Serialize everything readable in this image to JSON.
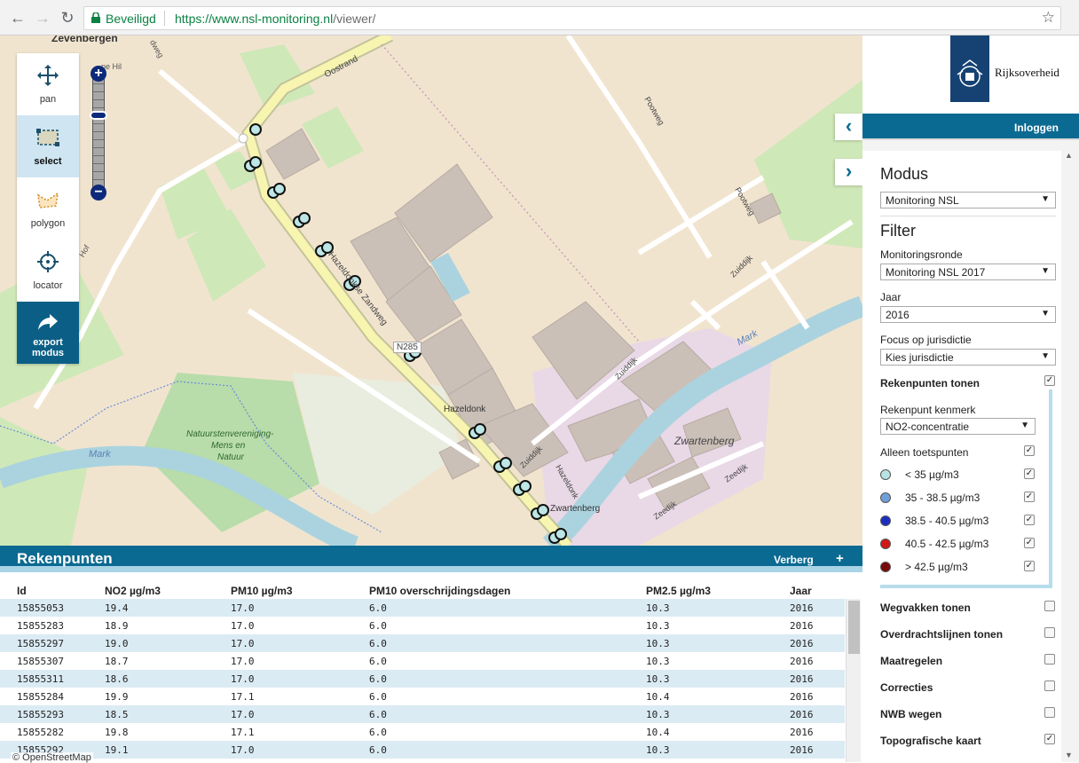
{
  "browser": {
    "secure_label": "Beveiligd",
    "url_origin": "https://www.nsl-monitoring.nl",
    "url_path": "/viewer/"
  },
  "map": {
    "labels": {
      "zevenbergen": "Zevenbergen",
      "oostrand": "Oostrand",
      "pootweg_1": "Pootweg",
      "pootweg_2": "Pootweg",
      "zuiddijk_1": "Zuiddijk",
      "zuiddijk_2": "Zuiddijk",
      "zuiddijk_3": "Zuiddijk",
      "hazeldonkse_zandweg": "Hazeldonkse Zandweg",
      "n285": "N285",
      "hazeldonk": "Hazeldonk",
      "hazeldonk_2": "Hazeldonk",
      "zwartenberg_1": "Zwartenberg",
      "zwartenberg_2": "Zwartenberg",
      "zeedijk_1": "Zeedijk",
      "zeedijk_2": "Zeedijk",
      "mark_1": "Mark",
      "mark_2": "Mark",
      "natuur_1": "Natuurstenvereniging-",
      "natuur_2": "Mens en",
      "natuur_3": "Natuur",
      "hof": "Hof",
      "dwaag": "dweg",
      "pe_hil": "pe Hil"
    }
  },
  "toolbar": {
    "items": [
      {
        "label": "pan",
        "icon": "move-icon"
      },
      {
        "label": "select",
        "icon": "select-box-icon"
      },
      {
        "label": "polygon",
        "icon": "polygon-icon"
      },
      {
        "label": "locator",
        "icon": "crosshair-icon"
      },
      {
        "label": "export\nmodus",
        "icon": "share-arrow-icon"
      }
    ],
    "active": "select"
  },
  "zoom": {
    "in": "+",
    "out": "−"
  },
  "rekenpunten": {
    "title": "Rekenpunten",
    "hide_label": "Verberg",
    "plus_label": "+",
    "columns": [
      "Id",
      "NO2 µg/m3",
      "PM10 µg/m3",
      "PM10 overschrijdingsdagen",
      "PM2.5 µg/m3",
      "Jaar"
    ],
    "rows": [
      [
        "15855053",
        "19.4",
        "17.0",
        "6.0",
        "10.3",
        "2016"
      ],
      [
        "15855283",
        "18.9",
        "17.0",
        "6.0",
        "10.3",
        "2016"
      ],
      [
        "15855297",
        "19.0",
        "17.0",
        "6.0",
        "10.3",
        "2016"
      ],
      [
        "15855307",
        "18.7",
        "17.0",
        "6.0",
        "10.3",
        "2016"
      ],
      [
        "15855311",
        "18.6",
        "17.0",
        "6.0",
        "10.3",
        "2016"
      ],
      [
        "15855284",
        "19.9",
        "17.1",
        "6.0",
        "10.4",
        "2016"
      ],
      [
        "15855293",
        "18.5",
        "17.0",
        "6.0",
        "10.3",
        "2016"
      ],
      [
        "15855282",
        "19.8",
        "17.1",
        "6.0",
        "10.4",
        "2016"
      ],
      [
        "15855292",
        "19.1",
        "17.0",
        "6.0",
        "10.3",
        "2016"
      ]
    ],
    "credit": "© OpenStreetMap"
  },
  "panel": {
    "brand": "Rijksoverheid",
    "login": "Inloggen",
    "modus_heading": "Modus",
    "modus_value": "Monitoring NSL",
    "filter_heading": "Filter",
    "ronde_label": "Monitoringsronde",
    "ronde_value": "Monitoring NSL 2017",
    "jaar_label": "Jaar",
    "jaar_value": "2016",
    "focus_label": "Focus op jurisdictie",
    "focus_value": "Kies jurisdictie",
    "rekenpunten_tonen": "Rekenpunten tonen",
    "kenmerk_label": "Rekenpunt kenmerk",
    "kenmerk_value": "NO2-concentratie",
    "alleen_toets": "Alleen toetspunten",
    "legend": [
      {
        "label": "< 35 µg/m3",
        "color": "#b8e3e3"
      },
      {
        "label": "35 - 38.5 µg/m3",
        "color": "#6f9fd8"
      },
      {
        "label": "38.5 - 40.5 µg/m3",
        "color": "#1a2fc0"
      },
      {
        "label": "40.5 - 42.5 µg/m3",
        "color": "#d01818"
      },
      {
        "label": "> 42.5 µg/m3",
        "color": "#7a0b0b"
      }
    ],
    "layers": [
      {
        "label": "Wegvakken tonen",
        "checked": false
      },
      {
        "label": "Overdrachtslijnen tonen",
        "checked": false
      },
      {
        "label": "Maatregelen",
        "checked": false
      },
      {
        "label": "Correcties",
        "checked": false
      },
      {
        "label": "NWB wegen",
        "checked": false
      },
      {
        "label": "Topografische kaart",
        "checked": true
      }
    ]
  }
}
